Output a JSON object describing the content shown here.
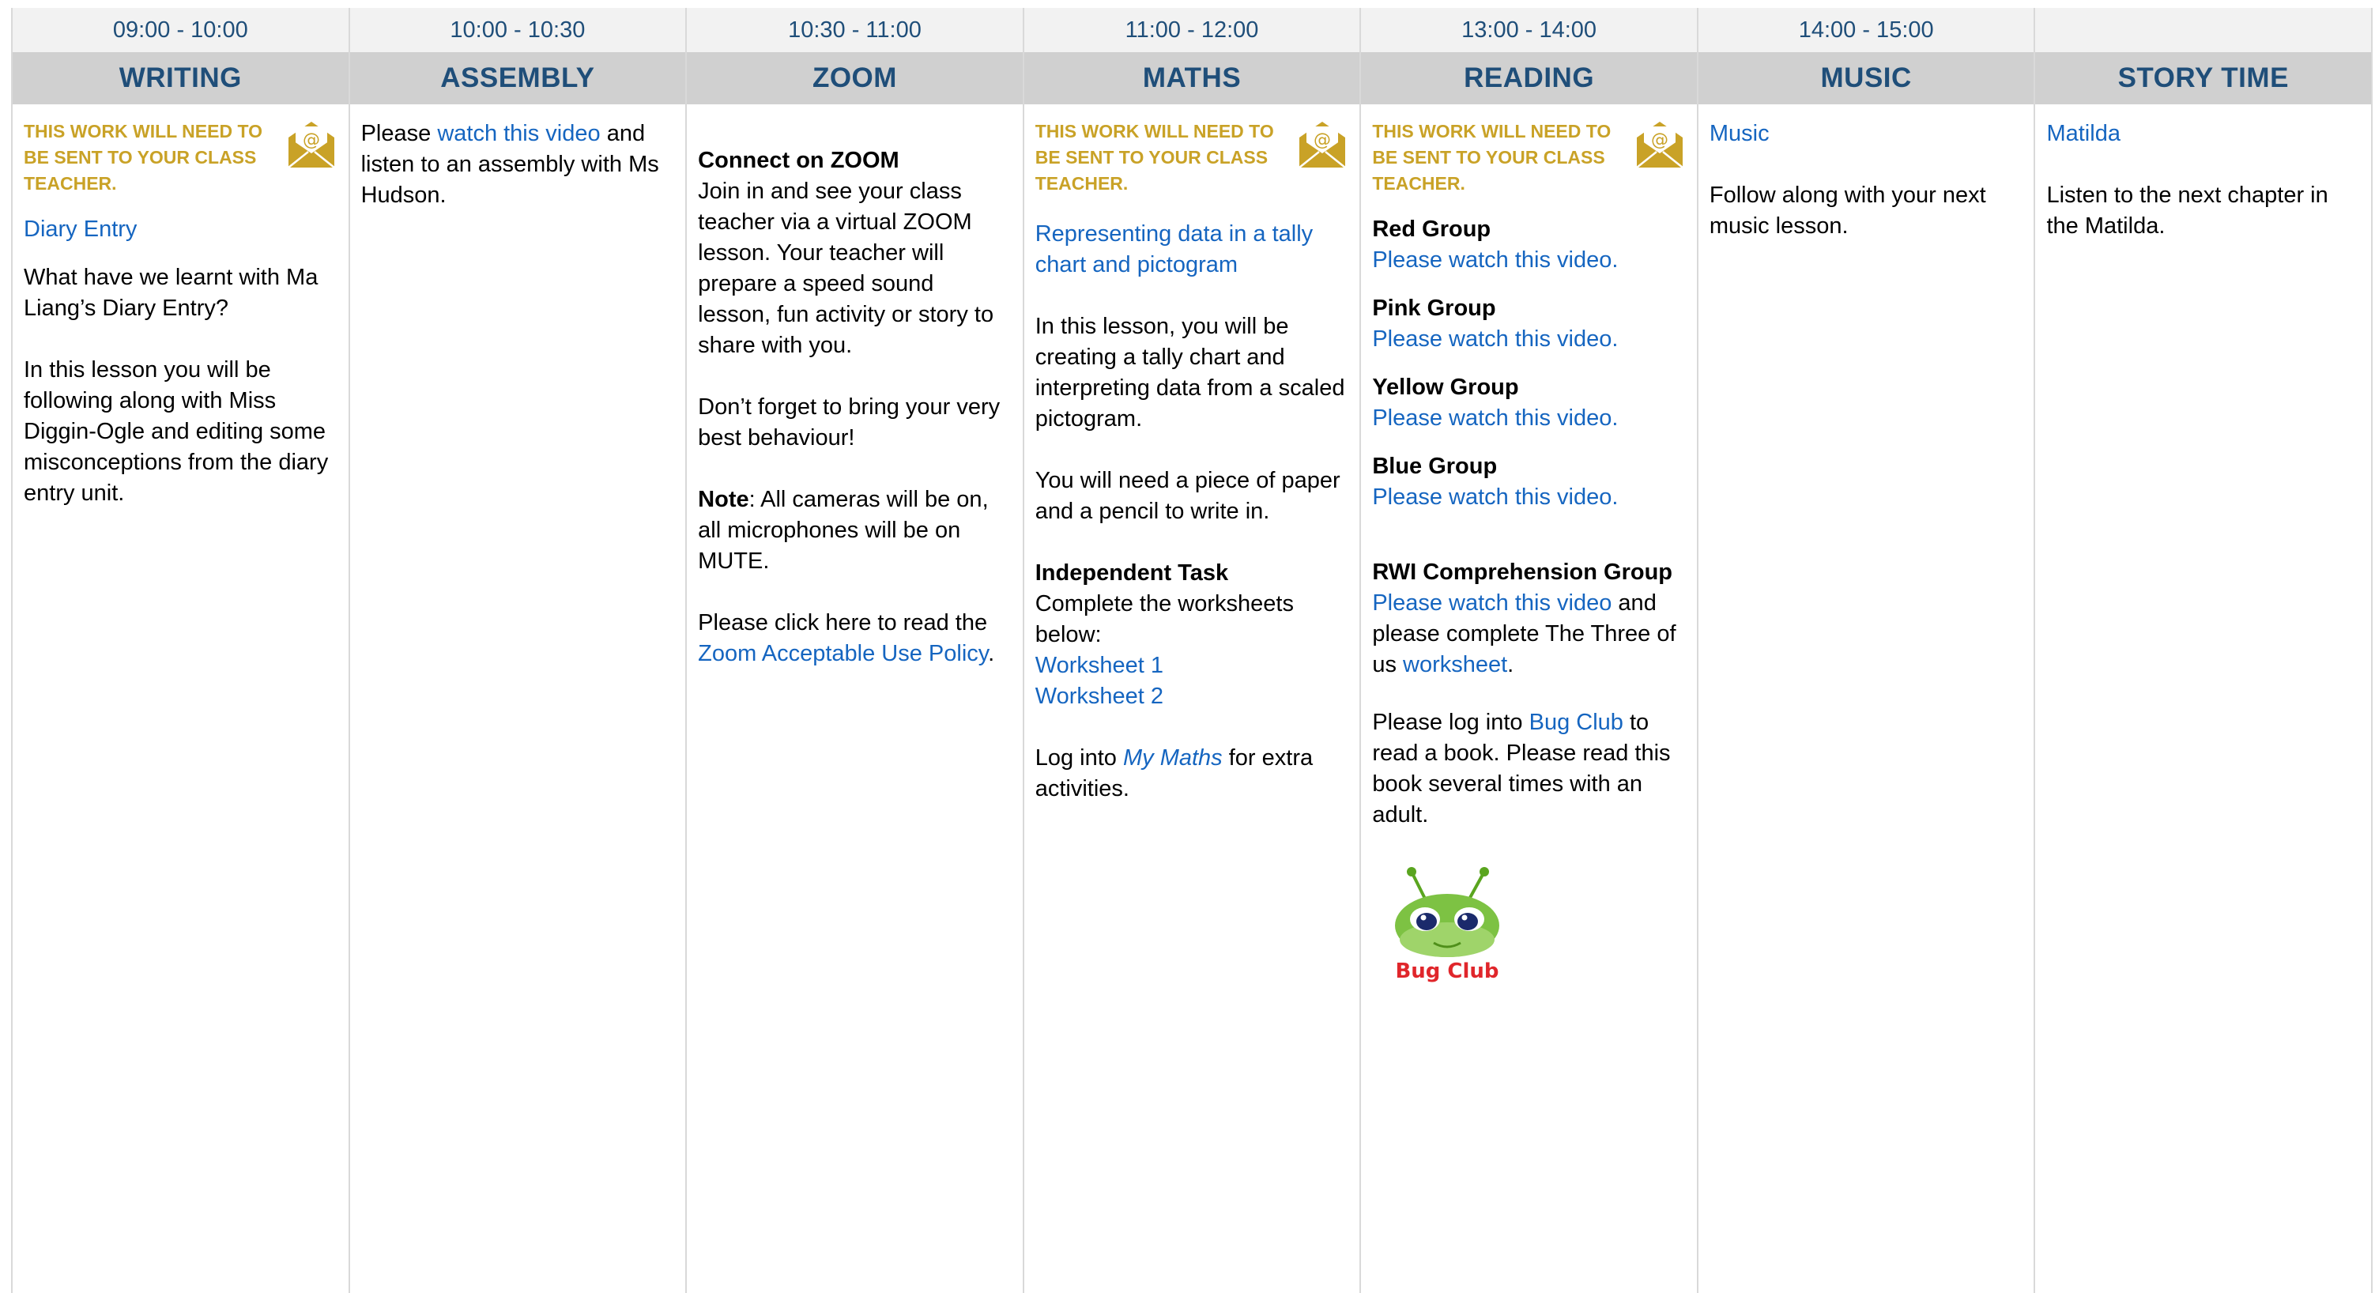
{
  "columns": [
    {
      "time": "09:00 - 10:00",
      "subject": "WRITING",
      "notice": "THIS WORK WILL NEED TO BE SENT TO YOUR CLASS TEACHER.",
      "link": "Diary Entry",
      "p1": "What have we learnt with Ma Liang’s Diary Entry?",
      "p2": "In this lesson you will be following along with Miss Diggin-Ogle and editing some misconceptions from the diary entry unit."
    },
    {
      "time": "10:00 - 10:30",
      "subject": "ASSEMBLY",
      "pre": "Please ",
      "link": "watch this video",
      "post": " and listen to an assembly with Ms Hudson."
    },
    {
      "time": "10:30 - 11:00",
      "subject": "ZOOM",
      "heading": "Connect on ZOOM",
      "p1": "Join in and see your class teacher via a virtual ZOOM lesson. Your teacher will prepare a speed sound lesson, fun activity or story to share with you.",
      "p2": "Don’t forget to bring your very best behaviour!",
      "note_label": "Note",
      "note_text": ": All cameras will be on, all microphones will be on MUTE.",
      "policy_pre": "Please click here to read the ",
      "policy_link": "Zoom Acceptable Use Policy",
      "policy_post": "."
    },
    {
      "time": "11:00 - 12:00",
      "subject": "MATHS",
      "notice": "THIS WORK WILL NEED TO BE SENT TO YOUR CLASS TEACHER.",
      "link": "Representing data in a tally chart and pictogram",
      "p1": "In this lesson, you will be creating a tally chart and interpreting data from a scaled pictogram.",
      "p2": "You will need a piece of paper and a pencil to write in.",
      "task_heading": "Independent Task",
      "task_text": "Complete the worksheets below:",
      "worksheet1": "Worksheet 1",
      "worksheet2": "Worksheet 2",
      "mymaths_pre": "Log into ",
      "mymaths_link": "My Maths",
      "mymaths_post": " for extra activities."
    },
    {
      "time": "13:00 - 14:00",
      "subject": "READING",
      "notice": "THIS WORK WILL NEED TO BE SENT TO YOUR CLASS TEACHER.",
      "groups": [
        {
          "name": "Red Group",
          "link": "Please watch this video."
        },
        {
          "name": "Pink Group",
          "link": "Please watch this video."
        },
        {
          "name": "Yellow Group",
          "link": "Please watch this video."
        },
        {
          "name": "Blue Group",
          "link": "Please watch this video."
        }
      ],
      "rwi_heading": "RWI Comprehension Group",
      "rwi_link": "Please watch this video",
      "rwi_mid": " and please complete The Three of us ",
      "rwi_link2": "worksheet",
      "rwi_post": ".",
      "bug_pre": "Please log into ",
      "bug_link": "Bug Club",
      "bug_post": " to read a book. Please read this book several times with an adult.",
      "bug_logo_text": "Bug Club"
    },
    {
      "time": "14:00 - 15:00",
      "subject": "MUSIC",
      "link": "Music",
      "p1": "Follow along with your next music lesson."
    },
    {
      "time": "",
      "subject": "STORY TIME",
      "link": "Matilda",
      "p1": "Listen to the next chapter in the Matilda."
    }
  ],
  "colors": {
    "header_text": "#1f4e79",
    "header_bg": "#d0d0d0",
    "time_bg": "#f2f2f2",
    "link": "#1565c0",
    "notice": "#c9a227"
  }
}
